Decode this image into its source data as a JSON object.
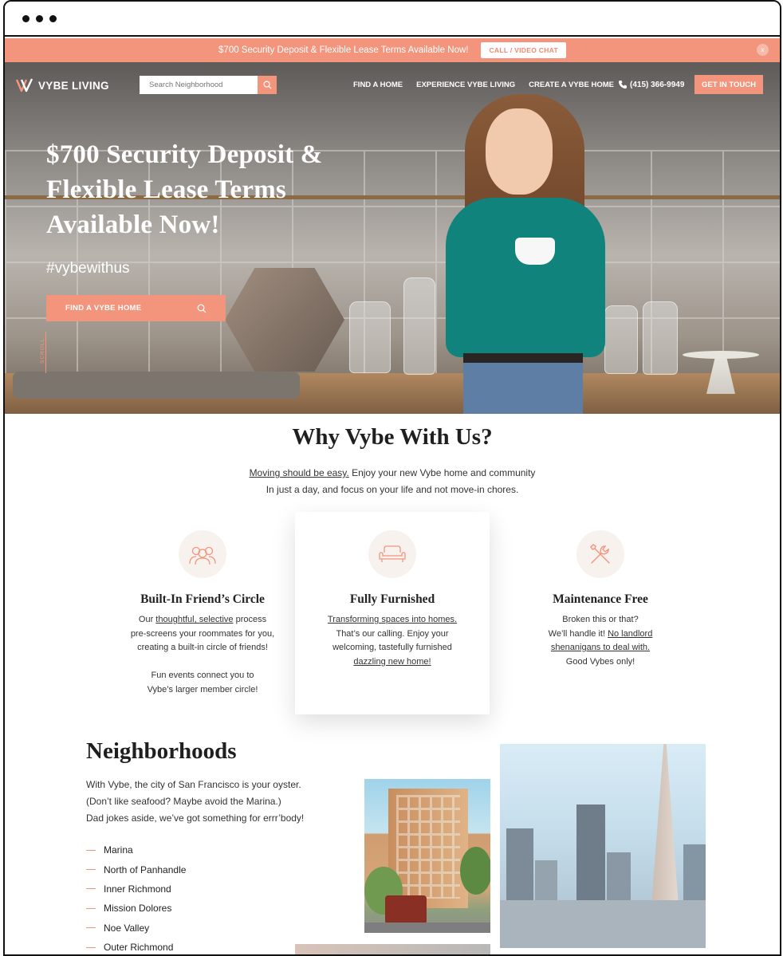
{
  "promo": {
    "text": "$700 Security Deposit & Flexible Lease Terms Available Now!",
    "cta_label": "CALL / VIDEO CHAT",
    "close_label": "x"
  },
  "nav": {
    "logo_text": "VYBE LIVING",
    "search_placeholder": "Search Neighborhood",
    "links": [
      "FIND A HOME",
      "EXPERIENCE VYBE LIVING",
      "CREATE A VYBE HOME"
    ],
    "phone": "(415) 366-9949",
    "cta_label": "GET IN TOUCH"
  },
  "hero": {
    "title": "$700 Security Deposit & Flexible Lease Terms Available Now!",
    "hashtag": "#vybewithus",
    "button_label": "FIND A VYBE HOME",
    "scroll_label": "SCROLL"
  },
  "why": {
    "title": "Why Vybe With Us?",
    "subtitle_link": "Moving should be easy.",
    "subtitle_rest": " Enjoy your new Vybe home and community",
    "subtitle_line2": "In just a day, and focus on your life and not move-in chores.",
    "features": [
      {
        "icon": "friends-icon",
        "title": "Built-In Friend’s Circle",
        "p1_pre": "Our ",
        "p1_link": "thoughtful, selective",
        "p1_post": " process",
        "p2": "pre-screens your roommates for you,",
        "p3": "creating a built-in circle of friends!",
        "p4": "Fun events connect you to",
        "p5": "Vybe’s larger member circle!"
      },
      {
        "icon": "sofa-icon",
        "title": "Fully Furnished",
        "p1_link": "Transforming spaces into homes.",
        "p2": "That’s our calling. Enjoy your",
        "p3": "welcoming, tastefully furnished",
        "p4_link": "dazzling new home!"
      },
      {
        "icon": "tools-icon",
        "title": "Maintenance Free",
        "p1": "Broken this or that?",
        "p2_pre": "We’ll handle it! ",
        "p2_link": "No landlord",
        "p3_link": "shenanigans to deal with.",
        "p4": "Good Vybes only!"
      }
    ]
  },
  "neighborhoods": {
    "title": "Neighborhoods",
    "text_line1": "With Vybe, the city of San Francisco is your oyster.",
    "text_line2": "(Don’t like seafood? Maybe avoid the Marina.)",
    "text_line3": "Dad jokes aside, we’ve got something for errr’body!",
    "items": [
      "Marina",
      "North of Panhandle",
      "Inner Richmond",
      "Mission Dolores",
      "Noe Valley",
      "Outer Richmond"
    ]
  },
  "colors": {
    "accent": "#f2957c",
    "heading": "#1f1f1f"
  }
}
